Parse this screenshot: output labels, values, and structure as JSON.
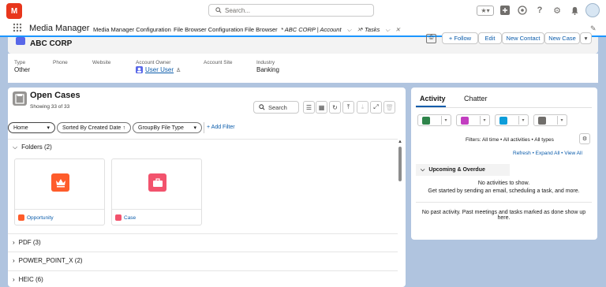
{
  "header": {
    "logo_text": "M",
    "search_placeholder": "Search...",
    "icons": [
      "star-icon",
      "add-icon",
      "cloud-icon",
      "help-icon",
      "setup-gear-icon",
      "notifications-bell-icon",
      "avatar"
    ]
  },
  "nav": {
    "app_name": "Media Manager",
    "tabs": [
      {
        "label": "Media Manager Configuration"
      },
      {
        "label": "File Browser Configuration"
      },
      {
        "label": "File Browser"
      },
      {
        "label": "* ABC CORP | Account"
      },
      {
        "label": "* Tasks"
      }
    ]
  },
  "record": {
    "title": "ABC CORP",
    "actions": [
      "+ Follow",
      "Edit",
      "New Contact",
      "New Case"
    ],
    "fields": [
      {
        "label": "Type",
        "value": "Other"
      },
      {
        "label": "Phone",
        "value": ""
      },
      {
        "label": "Website",
        "value": ""
      },
      {
        "label": "Account Owner",
        "value": "User User"
      },
      {
        "label": "Account Site",
        "value": ""
      },
      {
        "label": "Industry",
        "value": "Banking"
      }
    ]
  },
  "cases": {
    "title": "Open Cases",
    "subtitle": "Showing 33 of 33",
    "search_placeholder": "Search",
    "filters": {
      "home": "Home",
      "sort": "Sorted By Created Date",
      "group": "GroupBy File Type",
      "add_filter": "+ Add Filter"
    },
    "folders_label": "Folders (2)",
    "cards": [
      {
        "label": "Opportunity",
        "color": "#fe5c2b",
        "mini_color": "#fe5c2b"
      },
      {
        "label": "Case",
        "color": "#f2536d",
        "mini_color": "#f2536d"
      }
    ],
    "groups": [
      "PDF (3)",
      "POWER_POINT_X (2)",
      "HEIC (6)"
    ]
  },
  "activity": {
    "tabs": [
      "Activity",
      "Chatter"
    ],
    "buttons": [
      {
        "color": "#2e844a"
      },
      {
        "color": "#c23ec0"
      },
      {
        "color": "#0d9dda"
      },
      {
        "color": "#706e6b"
      }
    ],
    "filters_text": "Filters: All time • All activities • All types",
    "refresh": "Refresh",
    "expand_all": "Expand All",
    "view_all": "View All",
    "upcoming_label": "Upcoming & Overdue",
    "no_activities": "No activities to show.",
    "get_started": "Get started by sending an email, scheduling a task, and more.",
    "no_past": "No past activity. Past meetings and tasks marked as done show up here."
  }
}
